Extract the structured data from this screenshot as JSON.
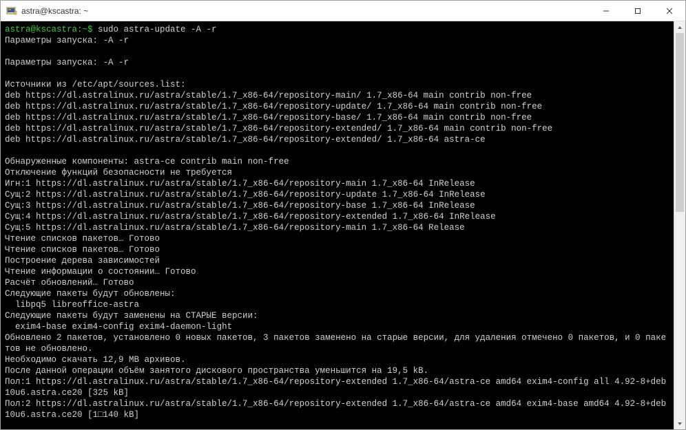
{
  "window": {
    "title": "astra@kscastra: ~"
  },
  "terminal": {
    "prompt": "astra@kscastra:~$ ",
    "command": "sudo astra-update -A -r",
    "lines": [
      "Параметры запуска: -A -r",
      "",
      "Параметры запуска: -A -r",
      "",
      "Источники из /etc/apt/sources.list:",
      "deb https://dl.astralinux.ru/astra/stable/1.7_x86-64/repository-main/ 1.7_x86-64 main contrib non-free",
      "deb https://dl.astralinux.ru/astra/stable/1.7_x86-64/repository-update/ 1.7_x86-64 main contrib non-free",
      "deb https://dl.astralinux.ru/astra/stable/1.7_x86-64/repository-base/ 1.7_x86-64 main contrib non-free",
      "deb https://dl.astralinux.ru/astra/stable/1.7_x86-64/repository-extended/ 1.7_x86-64 main contrib non-free",
      "deb https://dl.astralinux.ru/astra/stable/1.7_x86-64/repository-extended/ 1.7_x86-64 astra-ce",
      "",
      "Обнаруженные компоненты: astra-ce contrib main non-free",
      "Отключение функций безопасности не требуется",
      "Игн:1 https://dl.astralinux.ru/astra/stable/1.7_x86-64/repository-main 1.7_x86-64 InRelease",
      "Сущ:2 https://dl.astralinux.ru/astra/stable/1.7_x86-64/repository-update 1.7_x86-64 InRelease",
      "Сущ:3 https://dl.astralinux.ru/astra/stable/1.7_x86-64/repository-base 1.7_x86-64 InRelease",
      "Сущ:4 https://dl.astralinux.ru/astra/stable/1.7_x86-64/repository-extended 1.7_x86-64 InRelease",
      "Сущ:5 https://dl.astralinux.ru/astra/stable/1.7_x86-64/repository-main 1.7_x86-64 Release",
      "Чтение списков пакетов… Готово",
      "Чтение списков пакетов… Готово",
      "Построение дерева зависимостей",
      "Чтение информации о состоянии… Готово",
      "Расчёт обновлений… Готово",
      "Следующие пакеты будут обновлены:",
      "  libpq5 libreoffice-astra",
      "Следующие пакеты будут заменены на СТАРЫЕ версии:",
      "  exim4-base exim4-config exim4-daemon-light",
      "Обновлено 2 пакетов, установлено 0 новых пакетов, 3 пакетов заменено на старые версии, для удаления отмечено 0 пакетов, и 0 пакетов не обновлено.",
      "Необходимо скачать 12,9 MB архивов.",
      "После данной операции объём занятого дискового пространства уменьшится на 19,5 kB.",
      "Пол:1 https://dl.astralinux.ru/astra/stable/1.7_x86-64/repository-extended 1.7_x86-64/astra-ce amd64 exim4-config all 4.92-8+deb10u6.astra.ce20 [325 kB]",
      "Пол:2 https://dl.astralinux.ru/astra/stable/1.7_x86-64/repository-extended 1.7_x86-64/astra-ce amd64 exim4-base amd64 4.92-8+deb10u6.astra.ce20 [1□140 kB]"
    ]
  }
}
